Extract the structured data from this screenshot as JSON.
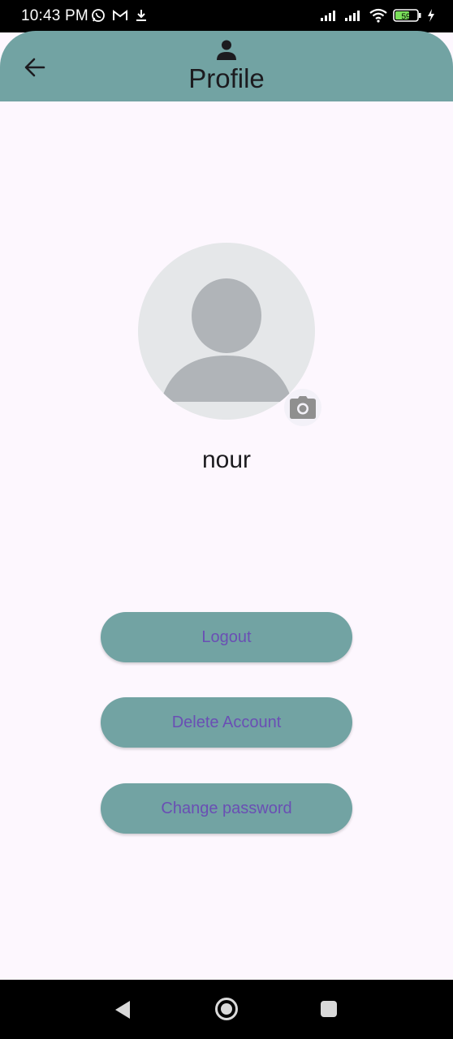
{
  "status_bar": {
    "time": "10:43 PM",
    "battery_level": "59",
    "icons_left": [
      "whatsapp-icon",
      "gmail-icon",
      "download-icon"
    ],
    "icons_right": [
      "signal-icon",
      "signal-icon",
      "wifi-icon",
      "battery-icon",
      "charging-icon"
    ]
  },
  "app_bar": {
    "title": "Profile",
    "title_icon": "person-icon",
    "back_icon": "arrow-back-icon",
    "background": "#72a3a3"
  },
  "profile": {
    "name": "nour",
    "avatar_icon": "default-avatar-icon",
    "edit_photo_icon": "camera-icon"
  },
  "actions": {
    "logout_label": "Logout",
    "delete_label": "Delete Account",
    "change_password_label": "Change password",
    "button_color": "#72a3a3",
    "text_color": "#6a4fb4"
  },
  "nav_bar": {
    "icons": [
      "nav-back-icon",
      "nav-home-icon",
      "nav-recents-icon"
    ]
  }
}
